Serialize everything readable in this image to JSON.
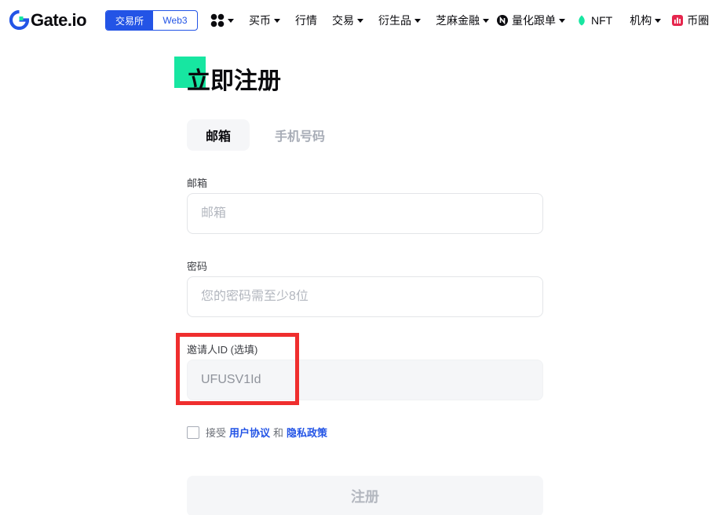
{
  "header": {
    "brand": "Gate.io",
    "switch": {
      "exchange": "交易所",
      "web3": "Web3"
    },
    "nav": [
      {
        "label": "买币",
        "has_caret": true
      },
      {
        "label": "行情",
        "has_caret": false
      },
      {
        "label": "交易",
        "has_caret": true
      },
      {
        "label": "衍生品",
        "has_caret": true
      },
      {
        "label": "芝麻金融",
        "has_caret": true
      },
      {
        "label": "量化跟单",
        "has_caret": true
      },
      {
        "label": "NFT",
        "has_caret": false
      },
      {
        "label": "机构",
        "has_caret": true
      },
      {
        "label": "币圈",
        "has_caret": false
      }
    ]
  },
  "form": {
    "title": "立即注册",
    "tabs": {
      "email": "邮箱",
      "phone": "手机号码"
    },
    "email": {
      "label": "邮箱",
      "placeholder": "邮箱",
      "value": ""
    },
    "password": {
      "label": "密码",
      "placeholder": "您的密码需至少8位",
      "value": ""
    },
    "referral": {
      "label": "邀请人ID (选填)",
      "value": "UFUSV1Id"
    },
    "agreement": {
      "prefix": "接受",
      "terms": "用户协议",
      "and": "和",
      "privacy": "隐私政策"
    },
    "submit_label": "注册"
  },
  "colors": {
    "brand_blue": "#2354e6",
    "accent_green": "#17e6a1",
    "highlight_red": "#ef2e2e"
  }
}
